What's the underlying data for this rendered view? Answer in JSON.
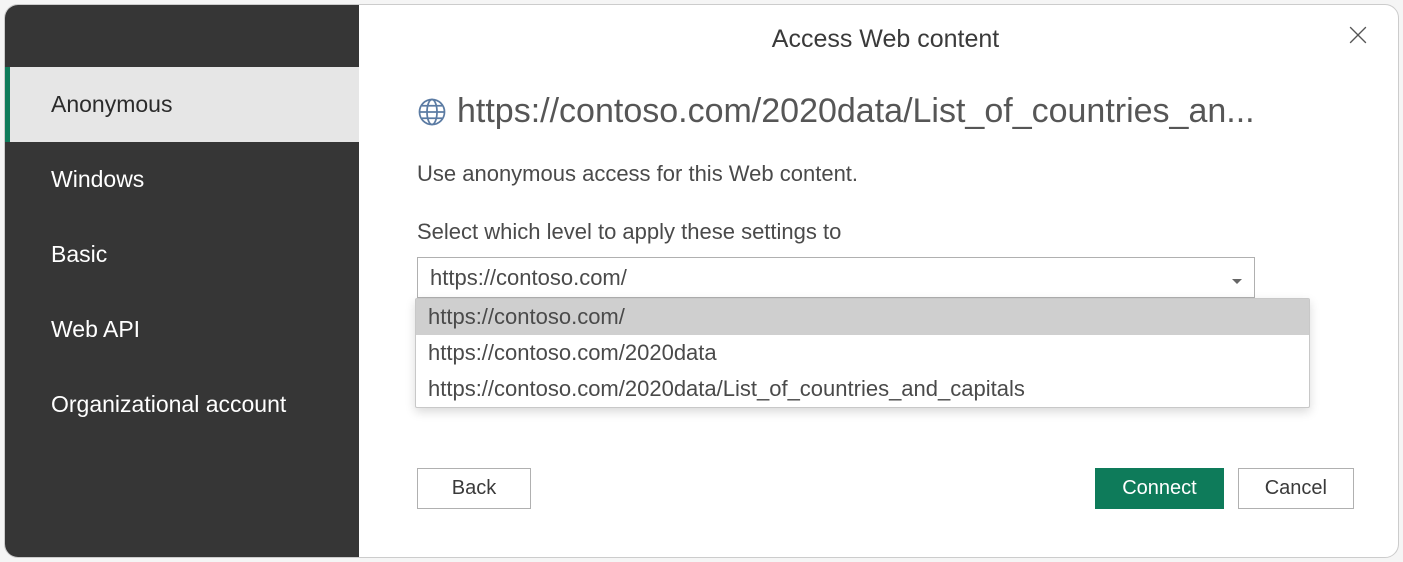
{
  "dialog": {
    "title": "Access Web content",
    "url": "https://contoso.com/2020data/List_of_countries_an...",
    "description": "Use anonymous access for this Web content.",
    "level_label": "Select which level to apply these settings to",
    "combo_value": "https://contoso.com/",
    "dropdown_options": [
      "https://contoso.com/",
      "https://contoso.com/2020data",
      "https://contoso.com/2020data/List_of_countries_and_capitals"
    ],
    "buttons": {
      "back": "Back",
      "connect": "Connect",
      "cancel": "Cancel"
    }
  },
  "sidebar": {
    "items": [
      {
        "label": "Anonymous",
        "selected": true
      },
      {
        "label": "Windows",
        "selected": false
      },
      {
        "label": "Basic",
        "selected": false
      },
      {
        "label": "Web API",
        "selected": false
      },
      {
        "label": "Organizational account",
        "selected": false
      }
    ]
  }
}
